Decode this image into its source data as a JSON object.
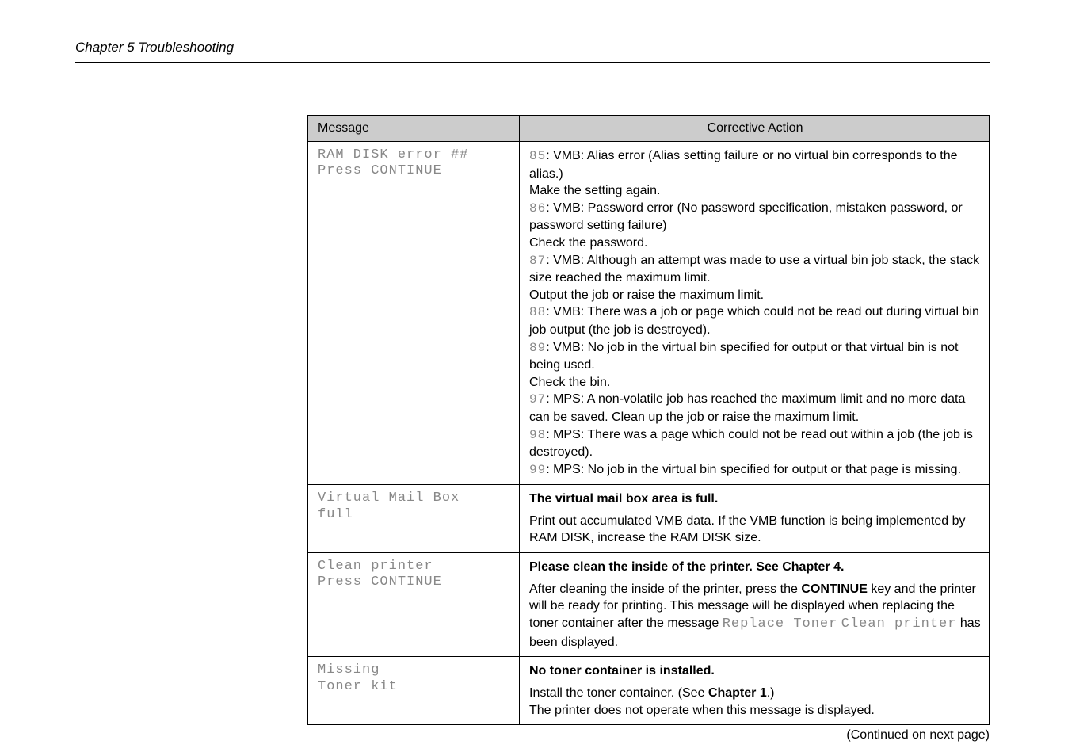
{
  "header": {
    "chapter": "Chapter 5 Troubleshooting"
  },
  "table": {
    "col_message": "Message",
    "col_action": "Corrective Action",
    "rows": [
      {
        "message_line1": "RAM DISK error ##",
        "message_line2": "Press CONTINUE",
        "codes": {
          "n85": "85",
          "t85a": ":  VMB: Alias error (Alias setting failure or no virtual bin corresponds to the alias.)",
          "t85b": "Make the setting again.",
          "n86": "86",
          "t86a": ":  VMB: Password error (No password specification, mistaken password, or password setting failure)",
          "t86b": "Check the password.",
          "n87": "87",
          "t87a": ":  VMB: Although an attempt was made to use a virtual bin job stack, the stack size reached the maximum limit.",
          "t87b": "Output the job or raise the maximum limit.",
          "n88": "88",
          "t88a": ":  VMB: There was a job or page which could not be read out during virtual bin job output (the job is destroyed).",
          "n89": "89",
          "t89a": ":  VMB: No job in the virtual bin specified for output or that virtual bin is not being used.",
          "t89b": "Check the bin.",
          "n97": "97",
          "t97a": ":  MPS: A non-volatile job has reached the maximum limit and no more data can be saved. Clean up the job or raise the maximum limit.",
          "n98": "98",
          "t98a": ":  MPS: There was a page which could not be read out within a job (the job is destroyed).",
          "n99": "99",
          "t99a": ":  MPS: No job in the virtual bin specified for output or that page is missing."
        }
      },
      {
        "message_line1": "Virtual Mail Box",
        "message_line2": "full",
        "bold_line": "The virtual mail box area is full.",
        "body": "Print out accumulated VMB data. If the VMB function is being implemented by RAM DISK, increase the RAM DISK size."
      },
      {
        "message_line1": "Clean printer",
        "message_line2": "Press CONTINUE",
        "bold_line": "Please clean the inside of the printer. See Chapter 4.",
        "body_pre": "After cleaning the inside of the printer, press the ",
        "body_bold": "CONTINUE",
        "body_mid": " key and the printer will be ready for printing. This message will be displayed when replacing the toner container after the message ",
        "code1": "Replace Toner",
        "code2": "Clean printer",
        "body_end": " has been displayed."
      },
      {
        "message_line1": "Missing",
        "message_line2": "Toner kit",
        "bold_line": "No toner container is installed.",
        "body_pre": "Install the toner container. (See ",
        "body_bold": "Chapter 1",
        "body_mid": ".)",
        "body_line2": "The printer does not operate when this message is displayed."
      }
    ]
  },
  "footer": {
    "continued": "(Continued on next page)"
  }
}
